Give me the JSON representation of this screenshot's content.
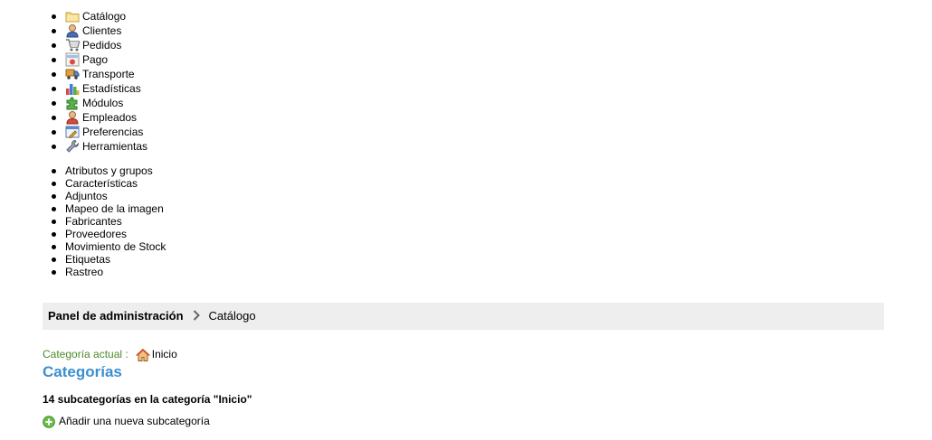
{
  "main_menu": [
    {
      "label": "Catálogo",
      "icon": "folder-icon"
    },
    {
      "label": "Clientes",
      "icon": "user-icon"
    },
    {
      "label": "Pedidos",
      "icon": "cart-icon"
    },
    {
      "label": "Pago",
      "icon": "payment-icon"
    },
    {
      "label": "Transporte",
      "icon": "truck-icon"
    },
    {
      "label": "Estadísticas",
      "icon": "chart-icon"
    },
    {
      "label": "Módulos",
      "icon": "puzzle-icon"
    },
    {
      "label": "Empleados",
      "icon": "employee-icon"
    },
    {
      "label": "Preferencias",
      "icon": "preferences-icon"
    },
    {
      "label": "Herramientas",
      "icon": "wrench-icon"
    }
  ],
  "sub_menu": [
    "Atributos y grupos",
    "Características",
    "Adjuntos",
    "Mapeo de la imagen",
    "Fabricantes",
    "Proveedores",
    "Movimiento de Stock",
    "Etiquetas",
    "Rastreo"
  ],
  "breadcrumb": {
    "root": "Panel de administración",
    "current": "Catálogo"
  },
  "current_category": {
    "label": "Categoría actual :",
    "value": "Inicio"
  },
  "page_title": "Categorías",
  "subcategory_count": "14 subcategorías en la categoría \"Inicio\"",
  "add_subcategory": "Añadir una nueva subcategoría",
  "colors": {
    "title": "#3a8fd1",
    "current_label": "#4b8a2a",
    "breadcrumb_bg": "#eeeeee"
  }
}
